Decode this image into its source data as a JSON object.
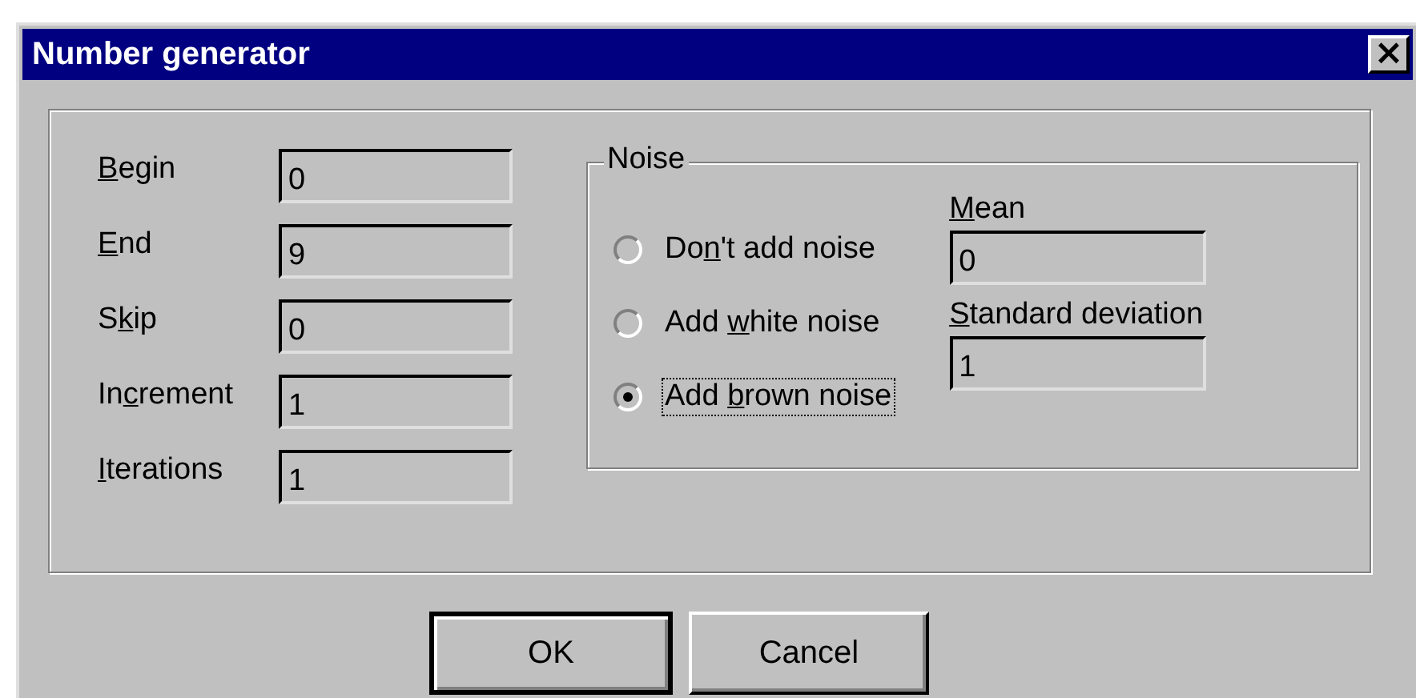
{
  "window": {
    "title": "Number generator",
    "close": "×"
  },
  "fields": [
    {
      "label": {
        "key": "B",
        "after": "egin"
      },
      "value": "0"
    },
    {
      "label": {
        "key": "E",
        "after": "nd"
      },
      "value": "9"
    },
    {
      "label": {
        "before": "S",
        "key": "k",
        "after": "ip"
      },
      "value": "0"
    },
    {
      "label": {
        "before": "In",
        "key": "c",
        "after": "rement"
      },
      "value": "1"
    },
    {
      "label": {
        "key": "I",
        "after": "terations"
      },
      "value": "1"
    }
  ],
  "noise": {
    "title": "Noise",
    "options": [
      {
        "label": {
          "before": "Do",
          "key": "n",
          "after": "'t add noise"
        },
        "selected": false,
        "focused": false
      },
      {
        "label": {
          "before": "Add ",
          "key": "w",
          "after": "hite noise"
        },
        "selected": false,
        "focused": false
      },
      {
        "label": {
          "before": "Add ",
          "key": "b",
          "after": "rown noise"
        },
        "selected": true,
        "focused": true
      }
    ],
    "fields": [
      {
        "label": {
          "key": "M",
          "after": "ean"
        },
        "value": "0"
      },
      {
        "label": {
          "key": "S",
          "after": "tandard deviation"
        },
        "value": "1"
      }
    ]
  },
  "buttons": [
    {
      "label": "OK",
      "default": true
    },
    {
      "label": "Cancel",
      "default": false
    }
  ]
}
